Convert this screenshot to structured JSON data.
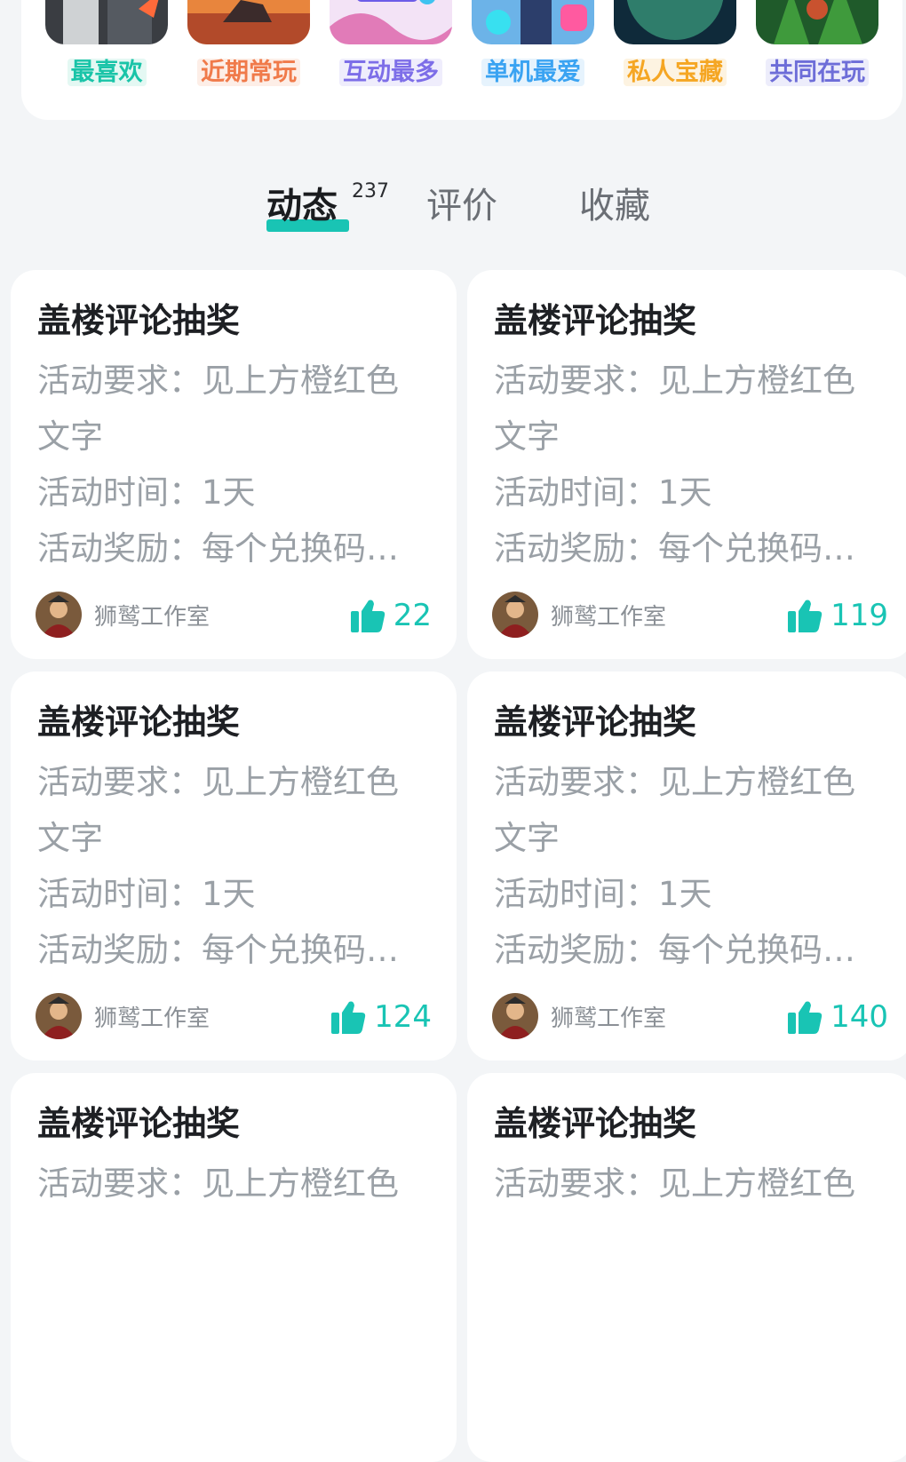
{
  "collections": [
    {
      "label": "最喜欢",
      "color": "#19c4a8",
      "bg": "#e4f8f3"
    },
    {
      "label": "近期常玩",
      "color": "#f07a4a",
      "bg": "#fdeee7"
    },
    {
      "label": "互动最多",
      "color": "#7d6ee8",
      "bg": "#efedfc"
    },
    {
      "label": "单机最爱",
      "color": "#3aa3f2",
      "bg": "#e6f3fd"
    },
    {
      "label": "私人宝藏",
      "color": "#f5a623",
      "bg": "#fdf3e1"
    },
    {
      "label": "共同在玩",
      "color": "#6d6dd8",
      "bg": "#ededfb"
    }
  ],
  "tabs": {
    "active": "动态",
    "active_count": "237",
    "review": "评价",
    "favorites": "收藏"
  },
  "posts": [
    {
      "title": "盖楼评论抽奖",
      "line1": "活动要求：见上方橙红色",
      "line2": "文字",
      "line3": "活动时间：1天",
      "line4": "活动奖励：每个兑换码…",
      "author": "狮鹫工作室",
      "likes": "22"
    },
    {
      "title": "盖楼评论抽奖",
      "line1": "活动要求：见上方橙红色",
      "line2": "文字",
      "line3": "活动时间：1天",
      "line4": "活动奖励：每个兑换码…",
      "author": "狮鹫工作室",
      "likes": "119"
    },
    {
      "title": "盖楼评论抽奖",
      "line1": "活动要求：见上方橙红色",
      "line2": "文字",
      "line3": "活动时间：1天",
      "line4": "活动奖励：每个兑换码…",
      "author": "狮鹫工作室",
      "likes": "124"
    },
    {
      "title": "盖楼评论抽奖",
      "line1": "活动要求：见上方橙红色",
      "line2": "文字",
      "line3": "活动时间：1天",
      "line4": "活动奖励：每个兑换码…",
      "author": "狮鹫工作室",
      "likes": "140"
    },
    {
      "title": "盖楼评论抽奖",
      "line1": "活动要求：见上方橙红色"
    },
    {
      "title": "盖楼评论抽奖",
      "line1": "活动要求：见上方橙红色"
    }
  ],
  "accent_color": "#19c4b4"
}
